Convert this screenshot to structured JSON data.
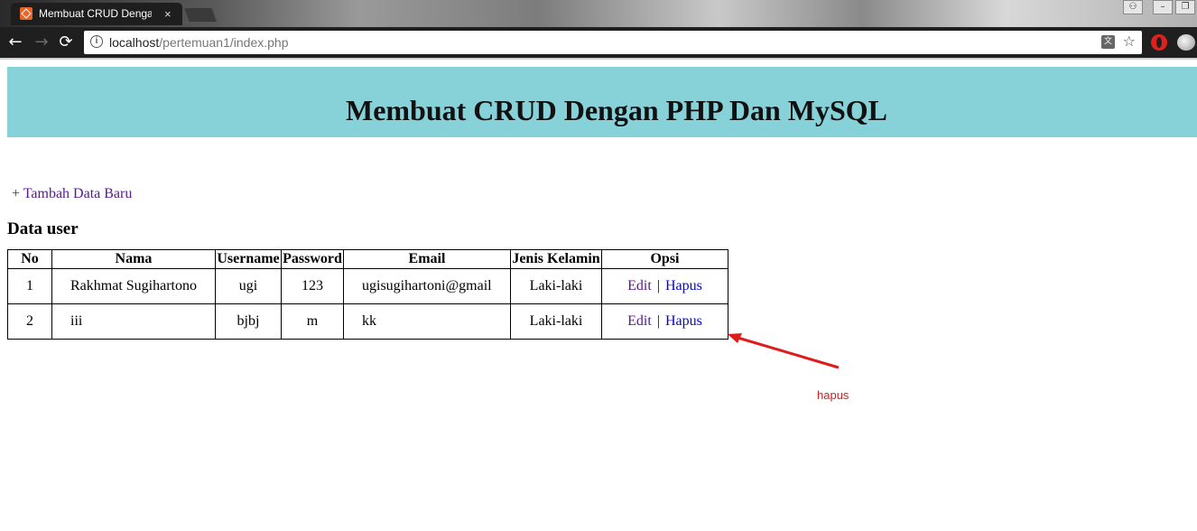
{
  "browser": {
    "tab_title": "Membuat CRUD Dengan PHP Dan MySQL",
    "tab_close": "×",
    "url_host": "localhost",
    "url_path": "/pertemuan1/index.php",
    "info_glyph": "i",
    "back_glyph": "←",
    "forward_glyph": "→",
    "reload_glyph": "⟳",
    "star_glyph": "☆",
    "translate_glyph": "文",
    "window_buttons": {
      "profile": "⚇",
      "minimize": "–",
      "restore": "❐"
    },
    "icons": [
      "back-arrow-icon",
      "forward-arrow-icon",
      "reload-icon",
      "info-icon",
      "translate-icon",
      "star-icon",
      "opera-icon",
      "extension-icon",
      "profile-icon"
    ],
    "accent_color": "#e8652a"
  },
  "page": {
    "header_title": "Membuat CRUD Dengan PHP Dan MySQL",
    "header_bg_color": "#87d1d8",
    "add_link": "+ Tambah Data Baru",
    "section_title": "Data user",
    "table": {
      "columns": [
        "No",
        "Nama",
        "Username",
        "Password",
        "Email",
        "Jenis Kelamin",
        "Opsi"
      ],
      "rows": [
        {
          "no": "1",
          "nama": "Rakhmat Sugihartono",
          "username": "ugi",
          "password": "123",
          "email": "ugisugihartoni@gmail",
          "jenis_kelamin": "Laki-laki",
          "edit": "Edit",
          "separator": "|",
          "hapus": "Hapus"
        },
        {
          "no": "2",
          "nama": "iii",
          "username": "bjbj",
          "password": "m",
          "email": "kk",
          "jenis_kelamin": "Laki-laki",
          "edit": "Edit",
          "separator": "|",
          "hapus": "Hapus"
        }
      ]
    }
  },
  "annotation": {
    "text": "hapus",
    "color": "#cc1f1f"
  }
}
